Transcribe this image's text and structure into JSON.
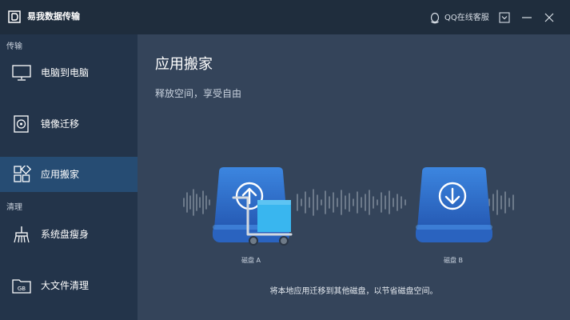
{
  "app": {
    "title": "易我数据传输",
    "qq_support": "QQ在线客服"
  },
  "sidebar": {
    "sections": [
      {
        "label": "传输"
      },
      {
        "label": "清理"
      }
    ],
    "items": [
      {
        "label": "电脑到电脑",
        "icon": "monitor-icon",
        "active": false
      },
      {
        "label": "镜像迁移",
        "icon": "disc-image-icon",
        "active": false
      },
      {
        "label": "应用搬家",
        "icon": "apps-grid-icon",
        "active": true
      },
      {
        "label": "系统盘瘦身",
        "icon": "broom-icon",
        "active": false
      },
      {
        "label": "大文件清理",
        "icon": "gb-folder-icon",
        "active": false
      }
    ]
  },
  "main": {
    "title": "应用搬家",
    "subtitle": "释放空间，享受自由",
    "disk_a_label": "磁盘 A",
    "disk_b_label": "磁盘 B",
    "description": "将本地应用迁移到其他磁盘，以节省磁盘空间。"
  },
  "colors": {
    "titlebar": "#1f2d3d",
    "sidebar": "#23344a",
    "sidebar_active": "#264c73",
    "main_bg": "#34445a",
    "disk_blue": "#2f73cf",
    "box_cyan": "#39b6ef"
  }
}
